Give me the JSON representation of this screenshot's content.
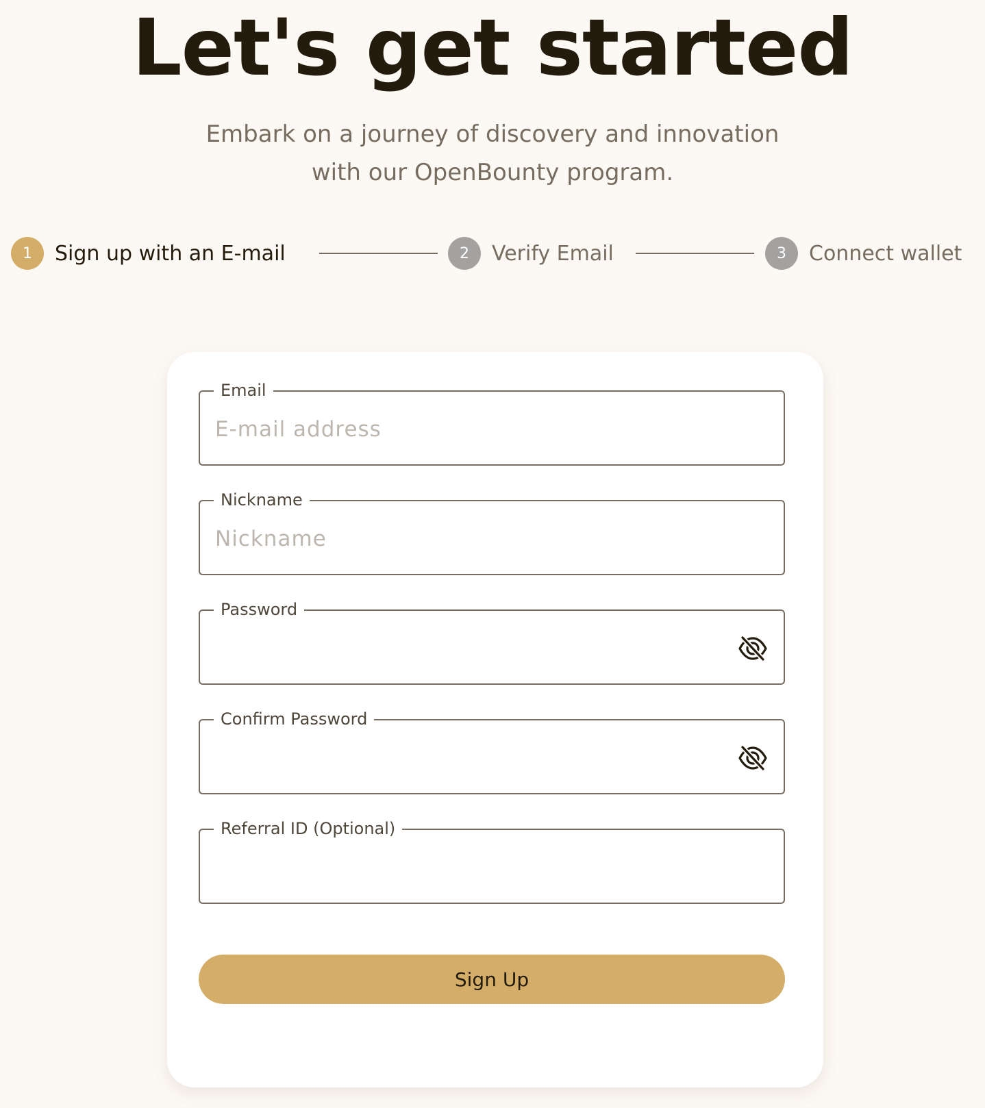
{
  "hero": {
    "title": "Let's get started",
    "subtitle_line1": "Embark on a journey of discovery and innovation",
    "subtitle_line2": "with our OpenBounty program."
  },
  "stepper": {
    "steps": [
      {
        "number": "1",
        "label": "Sign up with an E-mail",
        "state": "active"
      },
      {
        "number": "2",
        "label": "Verify Email",
        "state": "inactive"
      },
      {
        "number": "3",
        "label": "Connect wallet",
        "state": "inactive"
      }
    ]
  },
  "form": {
    "email": {
      "label": "Email",
      "placeholder": "E-mail address",
      "value": ""
    },
    "nickname": {
      "label": "Nickname",
      "placeholder": "Nickname",
      "value": ""
    },
    "password": {
      "label": "Password",
      "placeholder": "",
      "value": "",
      "icon": "eye-off-icon"
    },
    "confirm_password": {
      "label": "Confirm Password",
      "placeholder": "",
      "value": "",
      "icon": "eye-off-icon"
    },
    "referral": {
      "label": "Referral ID (Optional)",
      "placeholder": "",
      "value": ""
    },
    "submit_label": "Sign Up"
  },
  "colors": {
    "accent": "#d4ae69",
    "text_dark": "#231b0c",
    "text_muted": "#766d60",
    "step_inactive": "#a4a2a0",
    "page_background": "#fcf8f4",
    "card_background": "#ffffff"
  }
}
